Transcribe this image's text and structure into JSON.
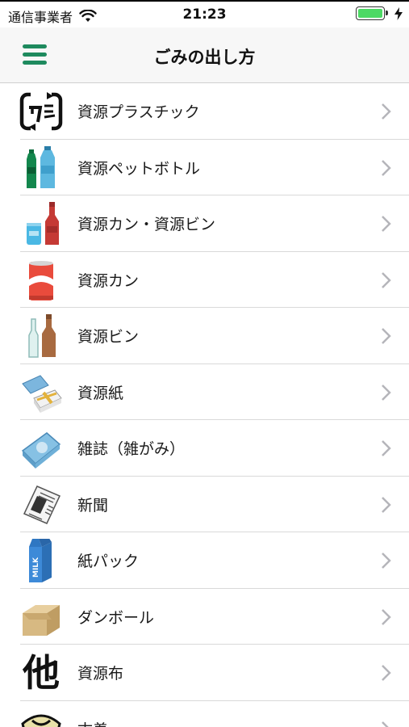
{
  "status_bar": {
    "carrier": "通信事業者",
    "time": "21:23",
    "battery_level": 1.0
  },
  "nav": {
    "title": "ごみの出し方",
    "menu_icon": "hamburger-menu-icon",
    "accent_color": "#1e8a5e"
  },
  "items": [
    {
      "label": "資源プラスチック",
      "icon": "plastic-recycle-icon"
    },
    {
      "label": "資源ペットボトル",
      "icon": "pet-bottle-icon"
    },
    {
      "label": "資源カン・資源ビン",
      "icon": "can-and-bottle-icon"
    },
    {
      "label": "資源カン",
      "icon": "can-icon"
    },
    {
      "label": "資源ビン",
      "icon": "glass-bottle-icon"
    },
    {
      "label": "資源紙",
      "icon": "paper-bundle-icon"
    },
    {
      "label": "雑誌（雑がみ）",
      "icon": "magazine-icon"
    },
    {
      "label": "新聞",
      "icon": "newspaper-icon"
    },
    {
      "label": "紙パック",
      "icon": "milk-carton-icon"
    },
    {
      "label": "ダンボール",
      "icon": "cardboard-box-icon"
    },
    {
      "label": "資源布",
      "icon": "cloth-icon",
      "glyph": "他"
    },
    {
      "label": "古着",
      "icon": "old-clothes-icon"
    }
  ],
  "carton_text": "MILK"
}
